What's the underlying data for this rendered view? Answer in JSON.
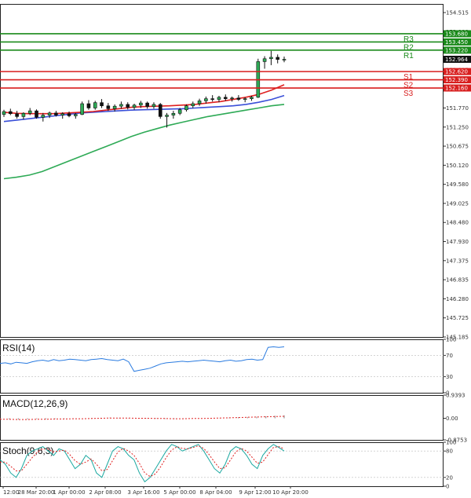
{
  "chart_data": {
    "type": "line",
    "main": {
      "ylim": [
        145.185,
        154.515
      ],
      "y_ticks": [
        "154.515",
        "153.980",
        "153.450",
        "152.915",
        "152.385",
        "151.770",
        "151.250",
        "150.675",
        "150.120",
        "149.580",
        "149.025",
        "148.480",
        "147.930",
        "147.375",
        "146.835",
        "146.280",
        "145.725",
        "145.185"
      ],
      "x_ticks": [
        "12:00",
        "28 Mar 20:00",
        "1 Apr 00:00",
        "2 Apr 08:00",
        "3 Apr 16:00",
        "5 Apr 00:00",
        "8 Apr 04:00",
        "9 Apr 12:00",
        "10 Apr 20:00"
      ],
      "current_price": "152.964",
      "levels": [
        {
          "name": "R3",
          "value": 153.68,
          "label": "153.680",
          "color": "#1a8a1a"
        },
        {
          "name": "R2",
          "value": 153.45,
          "label": "153.450",
          "color": "#1a8a1a"
        },
        {
          "name": "R1",
          "value": 153.22,
          "label": "153.220",
          "color": "#1a8a1a"
        },
        {
          "name": "S1",
          "value": 152.62,
          "label": "152.620",
          "color": "#d81e1e"
        },
        {
          "name": "S2",
          "value": 152.39,
          "label": "152.390",
          "color": "#d81e1e"
        },
        {
          "name": "S3",
          "value": 152.16,
          "label": "152.160",
          "color": "#d81e1e"
        }
      ],
      "candles": [
        [
          151.42,
          151.55,
          151.35,
          151.5
        ],
        [
          151.5,
          151.58,
          151.4,
          151.44
        ],
        [
          151.44,
          151.52,
          151.3,
          151.36
        ],
        [
          151.36,
          151.48,
          151.28,
          151.45
        ],
        [
          151.45,
          151.6,
          151.4,
          151.52
        ],
        [
          151.52,
          151.56,
          151.3,
          151.34
        ],
        [
          151.34,
          151.46,
          151.22,
          151.4
        ],
        [
          151.4,
          151.5,
          151.32,
          151.46
        ],
        [
          151.46,
          151.52,
          151.36,
          151.4
        ],
        [
          151.4,
          151.48,
          151.3,
          151.44
        ],
        [
          151.44,
          151.5,
          151.34,
          151.38
        ],
        [
          151.38,
          151.46,
          151.3,
          151.42
        ],
        [
          151.42,
          151.78,
          151.4,
          151.72
        ],
        [
          151.72,
          151.82,
          151.55,
          151.6
        ],
        [
          151.6,
          151.8,
          151.55,
          151.75
        ],
        [
          151.75,
          151.85,
          151.6,
          151.66
        ],
        [
          151.66,
          151.74,
          151.52,
          151.58
        ],
        [
          151.58,
          151.7,
          151.5,
          151.65
        ],
        [
          151.65,
          151.78,
          151.58,
          151.7
        ],
        [
          151.7,
          151.76,
          151.56,
          151.62
        ],
        [
          151.62,
          151.72,
          151.55,
          151.68
        ],
        [
          151.68,
          151.8,
          151.6,
          151.74
        ],
        [
          151.74,
          151.78,
          151.58,
          151.64
        ],
        [
          151.64,
          151.76,
          151.58,
          151.7
        ],
        [
          151.7,
          151.74,
          151.3,
          151.36
        ],
        [
          151.36,
          151.46,
          151.05,
          151.4
        ],
        [
          151.4,
          151.52,
          151.3,
          151.45
        ],
        [
          151.45,
          151.6,
          151.4,
          151.55
        ],
        [
          151.55,
          151.7,
          151.5,
          151.66
        ],
        [
          151.66,
          151.78,
          151.6,
          151.72
        ],
        [
          151.72,
          151.86,
          151.66,
          151.8
        ],
        [
          151.8,
          151.92,
          151.72,
          151.86
        ],
        [
          151.86,
          151.96,
          151.78,
          151.84
        ],
        [
          151.84,
          151.94,
          151.76,
          151.9
        ],
        [
          151.9,
          151.98,
          151.8,
          151.86
        ],
        [
          151.86,
          151.92,
          151.78,
          151.88
        ],
        [
          151.88,
          151.96,
          151.8,
          151.84
        ],
        [
          151.84,
          151.9,
          151.76,
          151.86
        ],
        [
          151.86,
          151.94,
          151.8,
          151.9
        ],
        [
          151.9,
          152.98,
          151.88,
          152.9
        ],
        [
          152.9,
          153.05,
          152.7,
          152.98
        ],
        [
          152.98,
          153.2,
          152.8,
          153.02
        ],
        [
          153.02,
          153.1,
          152.85,
          152.96
        ],
        [
          152.96,
          153.04,
          152.88,
          152.964
        ]
      ],
      "ma_fast": [
        151.48,
        151.45,
        151.44,
        151.44,
        151.44,
        151.46,
        151.48,
        151.5,
        151.54,
        151.58,
        151.62,
        151.64,
        151.65,
        151.66,
        151.68,
        151.7,
        151.74,
        151.78,
        151.84,
        151.9,
        151.98,
        152.1,
        152.25
      ],
      "ma_mid": [
        151.22,
        151.26,
        151.3,
        151.34,
        151.38,
        151.42,
        151.46,
        151.48,
        151.5,
        151.52,
        151.54,
        151.55,
        151.56,
        151.57,
        151.58,
        151.6,
        151.62,
        151.64,
        151.66,
        151.7,
        151.76,
        151.84,
        151.95
      ],
      "ma_slow": [
        149.62,
        149.66,
        149.72,
        149.82,
        149.96,
        150.1,
        150.24,
        150.38,
        150.52,
        150.66,
        150.8,
        150.92,
        151.02,
        151.12,
        151.2,
        151.28,
        151.36,
        151.42,
        151.48,
        151.54,
        151.6,
        151.66,
        151.7
      ]
    },
    "rsi": {
      "title": "RSI(14)",
      "ylim": [
        0,
        100
      ],
      "ticks": [
        "100",
        "70",
        "30",
        "0"
      ],
      "levels": [
        70,
        30
      ],
      "values": [
        55,
        56,
        54,
        57,
        56,
        55,
        58,
        60,
        61,
        59,
        62,
        60,
        61,
        63,
        62,
        61,
        60,
        62,
        63,
        64,
        62,
        61,
        60,
        63,
        58,
        40,
        42,
        44,
        46,
        50,
        54,
        56,
        57,
        58,
        59,
        58,
        59,
        60,
        61,
        60,
        59,
        58,
        60,
        61,
        59,
        60,
        62,
        63,
        61,
        62,
        85,
        86,
        85,
        86
      ]
    },
    "macd": {
      "title": "MACD(12,26,9)",
      "ylim": [
        -0.8753,
        0.9393
      ],
      "ticks": [
        "0.9393",
        "0.00",
        "-0.8753"
      ],
      "histogram": [
        -0.05,
        -0.04,
        -0.05,
        -0.04,
        -0.03,
        -0.04,
        -0.03,
        -0.02,
        -0.01,
        0.0,
        0.01,
        0.02,
        0.03,
        0.02,
        0.01,
        0.0,
        -0.01,
        -0.02,
        -0.03,
        -0.03,
        -0.02,
        -0.01,
        0.0,
        0.01,
        0.02,
        0.03,
        0.04,
        0.05,
        0.06,
        0.08,
        0.1,
        0.12
      ],
      "signal": [
        -0.04,
        -0.04,
        -0.05,
        -0.05,
        -0.04,
        -0.04,
        -0.03,
        -0.03,
        -0.02,
        -0.02,
        -0.01,
        0.0,
        0.01,
        0.01,
        0.01,
        0.0,
        0.0,
        -0.01,
        -0.01,
        -0.02,
        -0.02,
        -0.01,
        -0.01,
        0.0,
        0.01,
        0.02,
        0.03,
        0.04,
        0.05,
        0.06,
        0.07,
        0.08
      ]
    },
    "stoch": {
      "title": "Stoch(9,6,3)",
      "ylim": [
        0,
        100
      ],
      "ticks": [
        "100",
        "80",
        "20",
        "0"
      ],
      "levels": [
        80,
        20
      ],
      "main": [
        60,
        50,
        30,
        20,
        40,
        70,
        80,
        85,
        90,
        80,
        70,
        85,
        80,
        60,
        40,
        50,
        70,
        60,
        30,
        20,
        50,
        80,
        90,
        85,
        70,
        60,
        30,
        10,
        20,
        40,
        60,
        80,
        95,
        90,
        80,
        85,
        90,
        95,
        80,
        60,
        40,
        30,
        50,
        80,
        90,
        85,
        70,
        50,
        40,
        70,
        85,
        95,
        88,
        80
      ],
      "signal": [
        55,
        55,
        45,
        35,
        35,
        50,
        65,
        78,
        85,
        84,
        78,
        80,
        82,
        72,
        58,
        50,
        55,
        62,
        50,
        35,
        38,
        58,
        78,
        86,
        80,
        70,
        52,
        30,
        22,
        28,
        45,
        65,
        82,
        90,
        86,
        85,
        88,
        92,
        86,
        72,
        55,
        40,
        42,
        60,
        78,
        86,
        80,
        66,
        52,
        55,
        72,
        88,
        90,
        85
      ]
    }
  }
}
